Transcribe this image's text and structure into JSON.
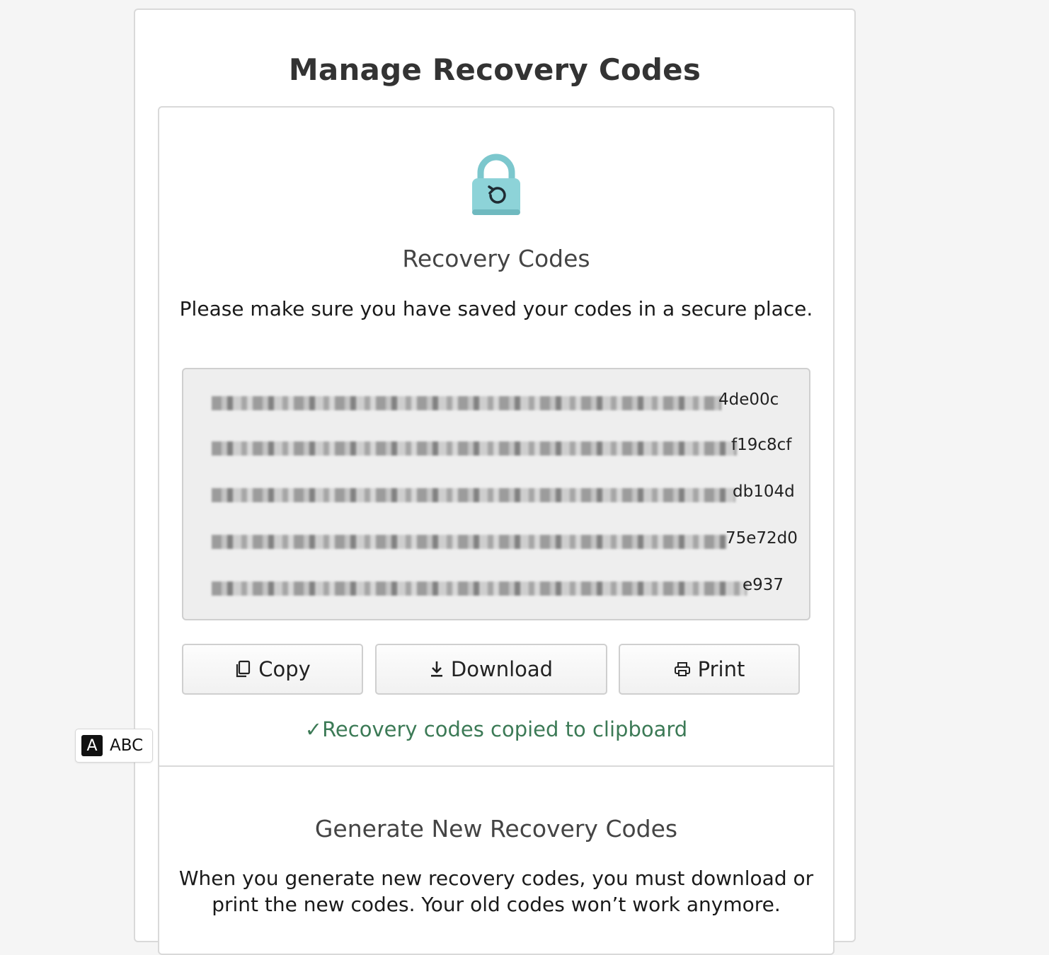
{
  "page": {
    "title": "Manage Recovery Codes"
  },
  "recovery": {
    "heading": "Recovery Codes",
    "instruction": "Please make sure you have saved your codes in a secure place.",
    "codes_visible_suffixes": [
      "4de00c",
      "f19c8cf",
      "db104d",
      "75e72d0",
      "e937"
    ]
  },
  "actions": {
    "copy_label": "Copy",
    "download_label": "Download",
    "print_label": "Print"
  },
  "status": {
    "message": "✓Recovery codes copied to clipboard",
    "color": "#3c7a56"
  },
  "generate": {
    "heading": "Generate New Recovery Codes",
    "line1": "When you generate new recovery codes, you must download or",
    "line2": "print the new codes. Your old codes won’t work anymore."
  },
  "input_indicator": {
    "key": "A",
    "label": "ABC"
  },
  "colors": {
    "lock_body": "#8dd3d8",
    "lock_shackle": "#7cc7cd",
    "background": "#f5f5f5"
  },
  "icons": {
    "lock": "lock-reset-icon",
    "copy": "copy-icon",
    "download": "download-icon",
    "print": "printer-icon"
  }
}
